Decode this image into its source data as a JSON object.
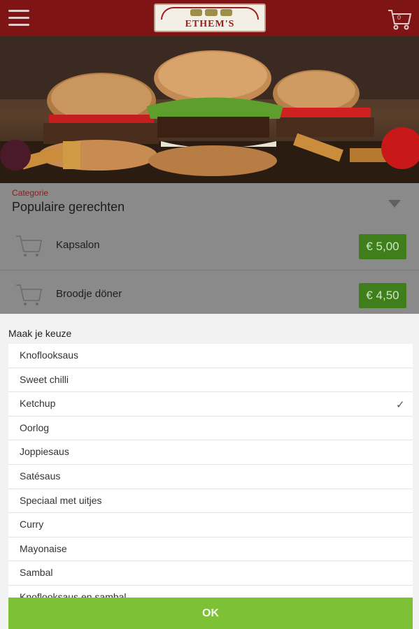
{
  "header": {
    "logo_text": "ETHEM'S",
    "cart_count": "0",
    "menu_icon": "hamburger-icon",
    "cart_icon": "shopping-cart-icon"
  },
  "hero": {
    "image": "burgers-photo"
  },
  "category": {
    "label": "Categorie",
    "value": "Populaire gerechten"
  },
  "menu": {
    "items": [
      {
        "name": "Kapsalon",
        "price": "€ 5,00"
      },
      {
        "name": "Broodje döner",
        "price": "€ 4,50"
      }
    ]
  },
  "dialog": {
    "title": "Maak je keuze",
    "options": [
      {
        "label": "Knoflooksaus",
        "selected": false
      },
      {
        "label": "Sweet chilli",
        "selected": false
      },
      {
        "label": "Ketchup",
        "selected": true
      },
      {
        "label": "Oorlog",
        "selected": false
      },
      {
        "label": "Joppiesaus",
        "selected": false
      },
      {
        "label": "Satésaus",
        "selected": false
      },
      {
        "label": "Speciaal met uitjes",
        "selected": false
      },
      {
        "label": "Curry",
        "selected": false
      },
      {
        "label": "Mayonaise",
        "selected": false
      },
      {
        "label": "Sambal",
        "selected": false
      },
      {
        "label": "Knoflooksaus en sambal",
        "selected": false
      }
    ],
    "check_glyph": "✓",
    "ok_label": "OK"
  },
  "colors": {
    "header_bg": "#7e1414",
    "price_bg": "#3f7e1b",
    "ok_bg": "#7dc137",
    "category_label": "#8d1c1c"
  }
}
